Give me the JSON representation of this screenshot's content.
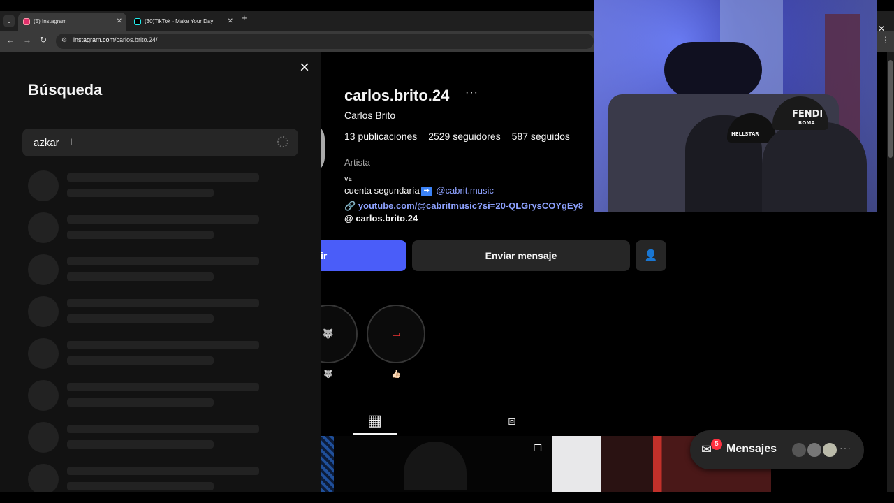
{
  "browser": {
    "tabs": [
      {
        "label": "(5) Instagram",
        "favicon": "instagram-icon",
        "active": true
      },
      {
        "label": "(30)TikTok - Make Your Day",
        "favicon": "tiktok-icon",
        "active": false
      }
    ],
    "url_host": "instagram.com",
    "url_path": "/carlos.brito.24/"
  },
  "search": {
    "title": "Búsqueda",
    "query": "azkar",
    "loading": true
  },
  "profile": {
    "username": "carlos.brito.24",
    "full_name": "Carlos Brito",
    "stats": {
      "posts": "13 publicaciones",
      "followers": "2529 seguidores",
      "following": "587 seguidos"
    },
    "category": "Artista",
    "bio_line1": "ᴠᴇ",
    "bio_line2_text": "cuenta segundaría",
    "bio_mention": "@cabrit.music",
    "link": "youtube.com/@cabritmusic?si=20-QLGrysCOYgEy8",
    "threads": "carlos.brito.24"
  },
  "actions": {
    "follow_label": "ir",
    "message_label": "Enviar mensaje"
  },
  "highlights": [
    {
      "icon": "wolf-icon",
      "label": "🐺",
      "symbol": "🐺"
    },
    {
      "icon": "light-icon",
      "label": "👍🏻",
      "symbol": "▭"
    }
  ],
  "messages": {
    "label": "Mensajes",
    "badge": "5"
  },
  "webcam": {
    "cap_left_text": "HELLSTAR",
    "cap_right_text": "FENDI",
    "cap_right_sub": "ROMA"
  },
  "colors": {
    "accent_blue": "#4a5df9",
    "link_blue": "#8ea2ff",
    "badge_red": "#ff3040",
    "panel_bg": "#121212"
  }
}
